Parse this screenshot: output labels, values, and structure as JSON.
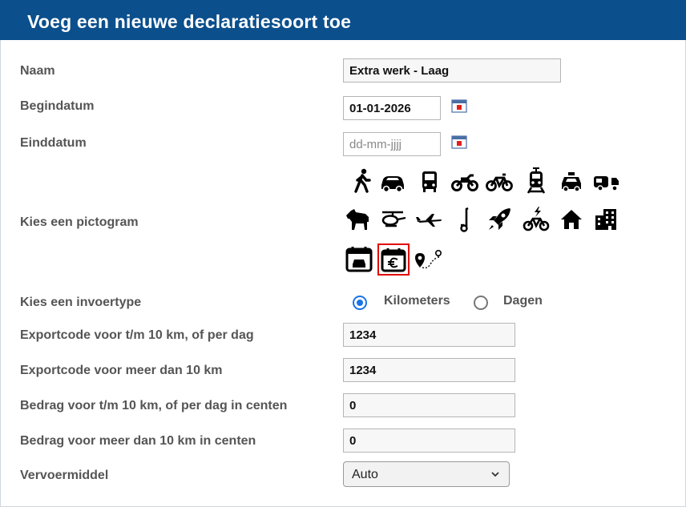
{
  "header": {
    "title": "Voeg een nieuwe declaratiesoort toe"
  },
  "form": {
    "naam": {
      "label": "Naam",
      "value": "Extra werk - Laag"
    },
    "begindatum": {
      "label": "Begindatum",
      "value": "01-01-2026",
      "icon": "calendar-icon"
    },
    "einddatum": {
      "label": "Einddatum",
      "value": "",
      "placeholder": "dd-mm-jjjj",
      "icon": "calendar-icon"
    },
    "pictogram": {
      "label": "Kies een pictogram",
      "icons": [
        "walking",
        "car",
        "bus",
        "motorcycle",
        "bicycle",
        "train",
        "taxi",
        "car-caravan",
        "horse",
        "helicopter",
        "airplane",
        "scooter",
        "rocket",
        "e-bike",
        "house",
        "building",
        "calendar-car",
        "calendar-euro",
        "route-pin"
      ],
      "selected": "calendar-euro",
      "selected_color": "#e10000"
    },
    "invoertype": {
      "label": "Kies een invoertype",
      "options": [
        "Kilometers",
        "Dagen"
      ],
      "selected": "Kilometers",
      "accent": "#1a73e8"
    },
    "exportcode_laag": {
      "label": "Exportcode voor t/m 10 km, of per dag",
      "value": "1234"
    },
    "exportcode_hoog": {
      "label": "Exportcode voor meer dan 10 km",
      "value": "1234"
    },
    "bedrag_laag": {
      "label": "Bedrag voor t/m 10 km, of per dag in centen",
      "value": "0"
    },
    "bedrag_hoog": {
      "label": "Bedrag voor meer dan 10 km in centen",
      "value": "0"
    },
    "vervoermiddel": {
      "label": "Vervoermiddel",
      "value": "Auto"
    }
  },
  "colors": {
    "header_bg": "#0b4f8c",
    "label_text": "#555555"
  }
}
